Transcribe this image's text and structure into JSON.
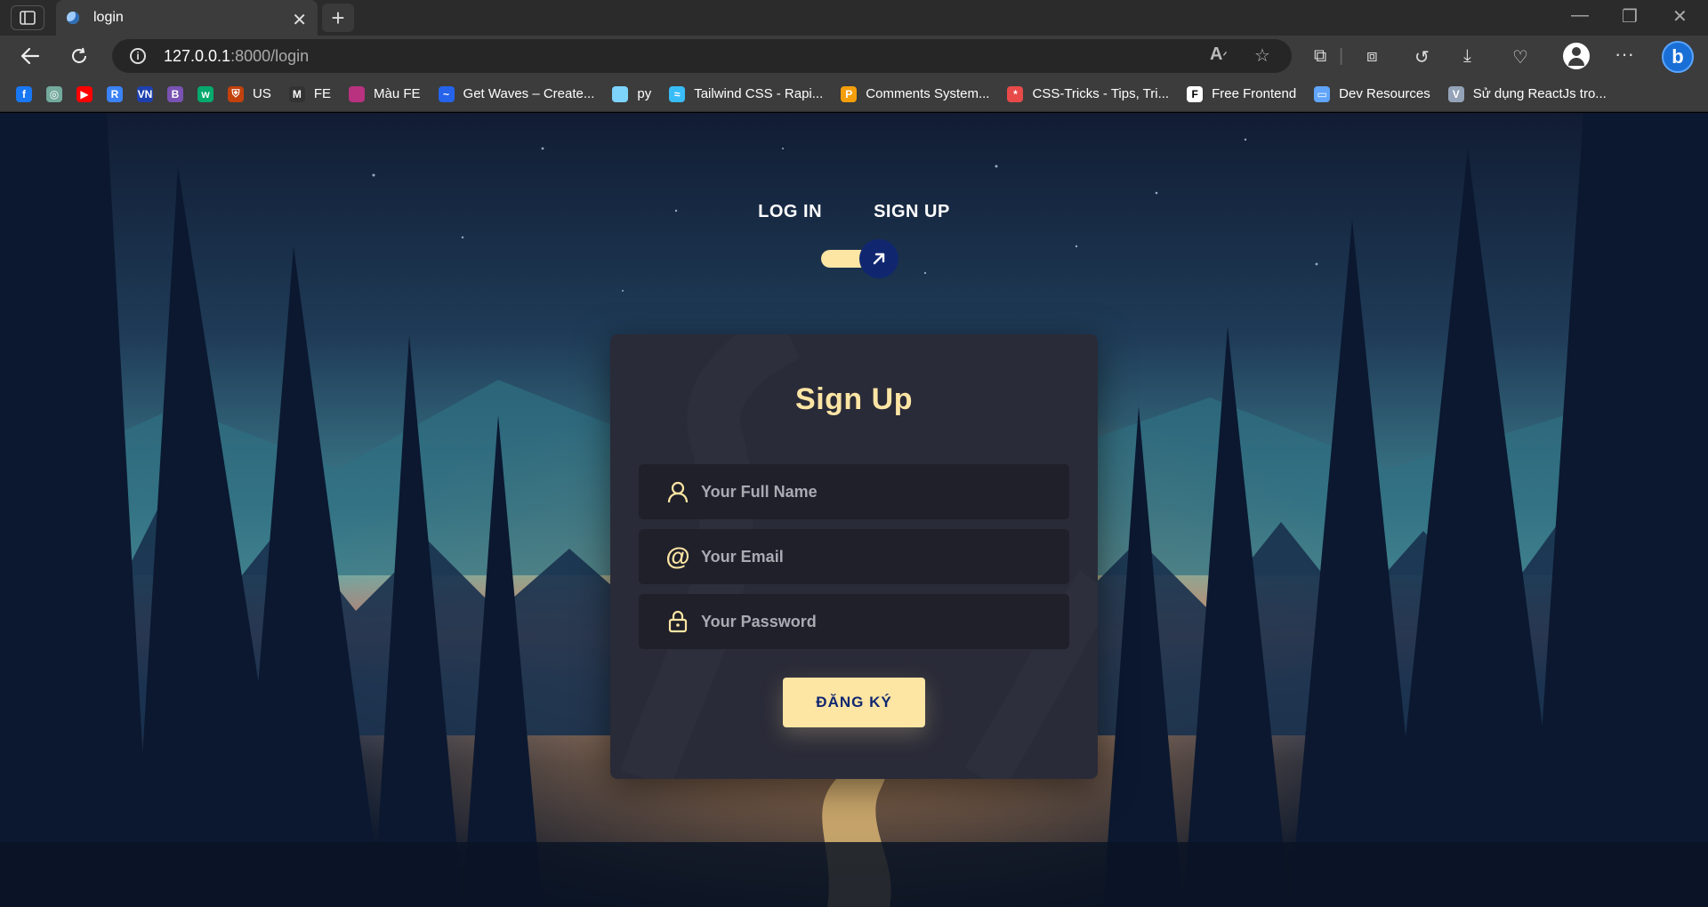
{
  "browser": {
    "tab_title": "login",
    "url_host": "127.0.0.1",
    "url_path": ":8000/login",
    "bookmarks": [
      {
        "label": "",
        "icon": "facebook-icon",
        "color": "#1877f2",
        "glyph": "f"
      },
      {
        "label": "",
        "icon": "chatgpt-icon",
        "color": "#74aa9c",
        "glyph": "◎"
      },
      {
        "label": "",
        "icon": "youtube-icon",
        "color": "#ff0000",
        "glyph": "▶"
      },
      {
        "label": "",
        "icon": "page-icon",
        "color": "#3b82f6",
        "glyph": "R"
      },
      {
        "label": "",
        "icon": "vn-icon",
        "color": "#1e40af",
        "glyph": "VN"
      },
      {
        "label": "",
        "icon": "bootstrap-icon",
        "color": "#7952b3",
        "glyph": "B"
      },
      {
        "label": "",
        "icon": "w3-icon",
        "color": "#04aa6d",
        "glyph": "w"
      },
      {
        "label": "US",
        "icon": "cambridge-icon",
        "color": "#c2410c",
        "glyph": "⛨"
      },
      {
        "label": "FE",
        "icon": "m-icon",
        "color": "#333333",
        "glyph": "M"
      },
      {
        "label": "Màu FE",
        "icon": "palette-icon",
        "color": "#b83280",
        "glyph": ""
      },
      {
        "label": "Get Waves – Create...",
        "icon": "waves-icon",
        "color": "#2563eb",
        "glyph": "~"
      },
      {
        "label": "py",
        "icon": "bottle-icon",
        "color": "#7dd3fc",
        "glyph": ""
      },
      {
        "label": "Tailwind CSS - Rapi...",
        "icon": "tailwind-icon",
        "color": "#38bdf8",
        "glyph": "≈"
      },
      {
        "label": "Comments System...",
        "icon": "comments-icon",
        "color": "#f59e0b",
        "glyph": "P"
      },
      {
        "label": "CSS-Tricks - Tips, Tri...",
        "icon": "csstricks-icon",
        "color": "#e84a4a",
        "glyph": "*"
      },
      {
        "label": "Free Frontend",
        "icon": "freefrontend-icon",
        "color": "#ffffff",
        "glyph": "F"
      },
      {
        "label": "Dev Resources",
        "icon": "monitor-icon",
        "color": "#60a5fa",
        "glyph": "▭"
      },
      {
        "label": "Sử dụng ReactJs tro...",
        "icon": "v-icon",
        "color": "#94a3b8",
        "glyph": "V"
      }
    ]
  },
  "switcher": {
    "login_label": "LOG IN",
    "signup_label": "SIGN UP",
    "toggle_on": true
  },
  "form": {
    "title": "Sign Up",
    "name_placeholder": "Your Full Name",
    "email_placeholder": "Your Email",
    "password_placeholder": "Your Password",
    "submit_label": "ĐĂNG KÝ"
  },
  "colors": {
    "accent": "#fde5a4",
    "card_bg": "#2a2b38",
    "field_bg": "#1f2029",
    "knob": "#102770"
  }
}
